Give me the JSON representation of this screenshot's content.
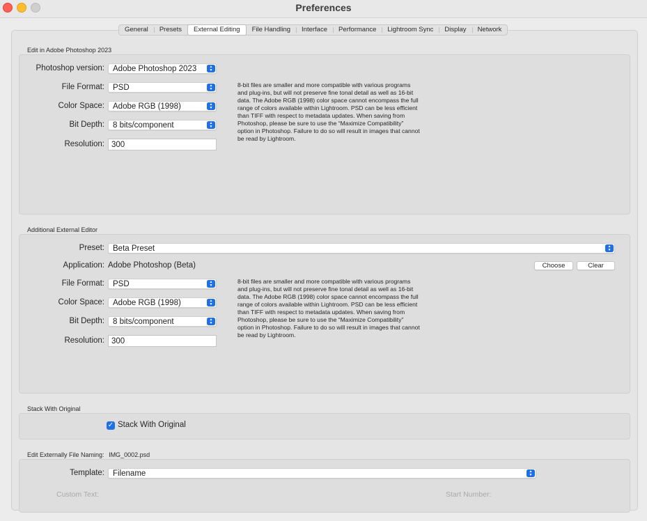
{
  "window": {
    "title": "Preferences"
  },
  "tabs": [
    {
      "label": "General"
    },
    {
      "label": "Presets"
    },
    {
      "label": "External Editing",
      "active": true
    },
    {
      "label": "File Handling"
    },
    {
      "label": "Interface"
    },
    {
      "label": "Performance"
    },
    {
      "label": "Lightroom Sync"
    },
    {
      "label": "Display"
    },
    {
      "label": "Network"
    }
  ],
  "photoshop_section": {
    "heading": "Edit in Adobe Photoshop 2023",
    "version_label": "Photoshop version:",
    "version_value": "Adobe Photoshop 2023",
    "format_label": "File Format:",
    "format_value": "PSD",
    "colorspace_label": "Color Space:",
    "colorspace_value": "Adobe RGB (1998)",
    "bitdepth_label": "Bit Depth:",
    "bitdepth_value": "8 bits/component",
    "resolution_label": "Resolution:",
    "resolution_value": "300",
    "description": "8-bit files are smaller and more compatible with various programs\nand plug-ins, but will not preserve fine tonal detail as well as 16-bit\ndata. The Adobe RGB (1998) color space cannot encompass the full\nrange of colors available within Lightroom. PSD can be less efficient\nthan TIFF with respect to metadata updates. When saving from\nPhotoshop, please be sure to use the “Maximize Compatibility”\noption in Photoshop. Failure to do so will result in images that cannot\nbe read by Lightroom."
  },
  "additional_section": {
    "heading": "Additional External Editor",
    "preset_label": "Preset:",
    "preset_value": "Beta Preset",
    "application_label": "Application:",
    "application_value": "Adobe Photoshop (Beta)",
    "choose_label": "Choose",
    "clear_label": "Clear",
    "format_label": "File Format:",
    "format_value": "PSD",
    "colorspace_label": "Color Space:",
    "colorspace_value": "Adobe RGB (1998)",
    "bitdepth_label": "Bit Depth:",
    "bitdepth_value": "8 bits/component",
    "resolution_label": "Resolution:",
    "resolution_value": "300",
    "description": "8-bit files are smaller and more compatible with various programs\nand plug-ins, but will not preserve fine tonal detail as well as 16-bit\ndata. The Adobe RGB (1998) color space cannot encompass the full\nrange of colors available within Lightroom. PSD can be less efficient\nthan TIFF with respect to metadata updates. When saving from\nPhotoshop, please be sure to use the “Maximize Compatibility”\noption in Photoshop. Failure to do so will result in images that cannot\nbe read by Lightroom."
  },
  "stack_section": {
    "heading": "Stack With Original",
    "checkbox_label": "Stack With Original",
    "checked": true
  },
  "naming_section": {
    "heading": "Edit Externally File Naming:",
    "example": "IMG_0002.psd",
    "template_label": "Template:",
    "template_value": "Filename",
    "custom_text_label": "Custom Text:",
    "start_number_label": "Start Number:"
  },
  "colors": {
    "accent": "#1f6fe5"
  }
}
